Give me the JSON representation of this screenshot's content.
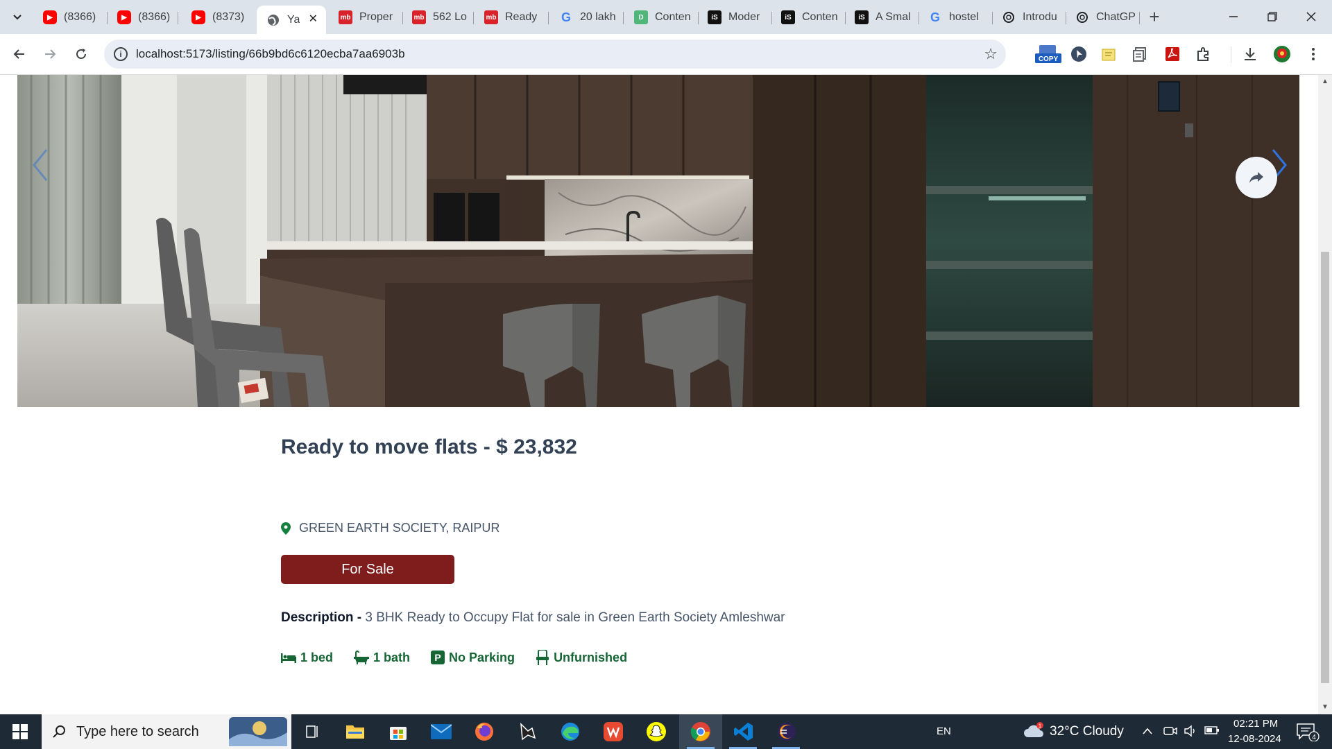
{
  "browser": {
    "tabs": [
      {
        "title": "(8366)",
        "icon": "youtube-icon"
      },
      {
        "title": "(8366)",
        "icon": "youtube-icon"
      },
      {
        "title": "(8373)",
        "icon": "youtube-icon"
      },
      {
        "title": "Ya",
        "icon": "globe-icon",
        "active": true
      },
      {
        "title": "Proper",
        "icon": "magicbricks-icon"
      },
      {
        "title": "562 Lo",
        "icon": "magicbricks-icon"
      },
      {
        "title": "Ready",
        "icon": "magicbricks-icon"
      },
      {
        "title": "20 lakh",
        "icon": "google-icon"
      },
      {
        "title": "Conten",
        "icon": "docs-icon"
      },
      {
        "title": "Moder",
        "icon": "is-icon"
      },
      {
        "title": "Conten",
        "icon": "is-icon"
      },
      {
        "title": "A Smal",
        "icon": "is-icon"
      },
      {
        "title": "hostel",
        "icon": "google-icon"
      },
      {
        "title": "Introdu",
        "icon": "openai-icon"
      },
      {
        "title": "ChatGP",
        "icon": "openai-icon"
      }
    ],
    "url": "localhost:5173/listing/66b9bd6c6120ecba7aa6903b",
    "extensions": [
      {
        "icon": "copy-extension-icon",
        "label": "COPY"
      },
      {
        "icon": "cursor-extension-icon"
      },
      {
        "icon": "notes-extension-icon"
      },
      {
        "icon": "tabs-extension-icon"
      },
      {
        "icon": "pdf-extension-icon"
      },
      {
        "icon": "puzzle-extensions-icon"
      },
      {
        "icon": "download-icon"
      },
      {
        "icon": "profile-avatar-icon"
      }
    ]
  },
  "listing": {
    "title": "Ready to move flats - $ 23,832",
    "address": "GREEN EARTH SOCIETY, RAIPUR",
    "badge": "For Sale",
    "description_label": "Description -",
    "description": " 3 BHK Ready to Occupy Flat for sale in Green Earth Society Amleshwar",
    "features": {
      "beds": "1 bed",
      "baths": "1 bath",
      "parking": "No Parking",
      "furnished": "Unfurnished"
    },
    "colors": {
      "title": "#334155",
      "badge": "#7f1d1d",
      "feature": "#166534"
    }
  },
  "taskbar": {
    "search_placeholder": "Type here to search",
    "language": "EN",
    "weather": "32°C  Cloudy",
    "weather_badge": "1",
    "time": "02:21 PM",
    "date": "12-08-2024",
    "notifications": "4",
    "apps": [
      "task-view-icon",
      "file-explorer-icon",
      "store-icon",
      "mail-icon",
      "firefox-icon",
      "inkscape-icon",
      "edge-icon",
      "wps-icon",
      "snapchat-icon",
      "chrome-icon",
      "vscode-icon",
      "eclipse-icon"
    ]
  }
}
